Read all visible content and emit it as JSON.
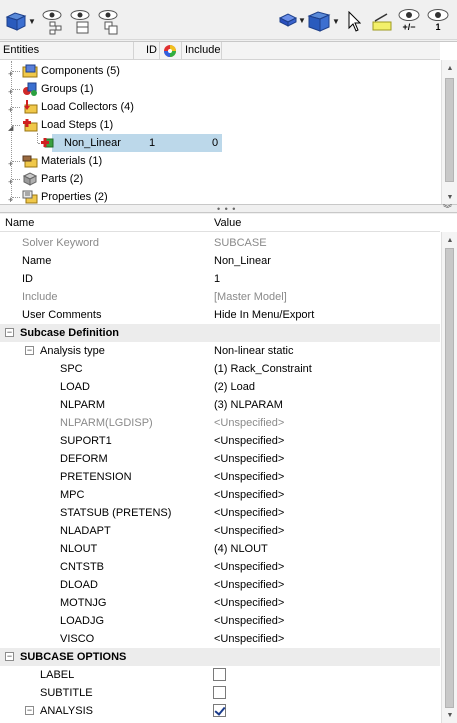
{
  "toolbar": {
    "left_icons": [
      "entity-view-icon",
      "entity-state-icon",
      "entity-filter-icon",
      "entity-config-icon"
    ],
    "right_icons": [
      "display-mode-icon",
      "view-mode-icon",
      "select-cursor-icon",
      "highlight-icon",
      "show-hide-icon",
      "isolate-icon"
    ],
    "show_hide_label": "+/−",
    "isolate_label": "1"
  },
  "tree": {
    "columns": {
      "entities": "Entities",
      "id": "ID",
      "include": "Include"
    },
    "rows": [
      {
        "label": "Components (5)",
        "icon": "components-icon",
        "indent": 0,
        "expanded": false
      },
      {
        "label": "Groups (1)",
        "icon": "groups-icon",
        "indent": 0,
        "expanded": false
      },
      {
        "label": "Load Collectors (4)",
        "icon": "load-collectors-icon",
        "indent": 0,
        "expanded": false
      },
      {
        "label": "Load Steps (1)",
        "icon": "load-steps-icon",
        "indent": 0,
        "expanded": true
      },
      {
        "label": "Non_Linear",
        "icon": "load-step-icon",
        "indent": 1,
        "id": "1",
        "include": "0",
        "selected": true
      },
      {
        "label": "Materials (1)",
        "icon": "materials-icon",
        "indent": 0,
        "expanded": false
      },
      {
        "label": "Parts (2)",
        "icon": "parts-icon",
        "indent": 0,
        "expanded": false
      },
      {
        "label": "Properties (2)",
        "icon": "properties-icon",
        "indent": 0,
        "expanded": false
      }
    ],
    "selected_id": "1",
    "selected_include": "0"
  },
  "props": {
    "header": {
      "name": "Name",
      "value": "Value"
    },
    "rows": [
      {
        "k": "Solver Keyword",
        "v": "SUBCASE",
        "grey": true
      },
      {
        "k": "Name",
        "v": "Non_Linear"
      },
      {
        "k": "ID",
        "v": "1"
      },
      {
        "k": "Include",
        "v": "[Master Model]",
        "grey": true
      },
      {
        "k": "User Comments",
        "v": "Hide In Menu/Export"
      },
      {
        "k": "Subcase Definition",
        "section": true
      },
      {
        "k": "Analysis type",
        "v": "Non-linear static",
        "sub": true
      },
      {
        "k": "SPC",
        "v": "(1) Rack_Constraint",
        "leaf": true
      },
      {
        "k": "LOAD",
        "v": "(2) Load",
        "leaf": true
      },
      {
        "k": "NLPARM",
        "v": "(3) NLPARAM",
        "leaf": true
      },
      {
        "k": "NLPARM(LGDISP)",
        "v": "<Unspecified>",
        "leaf": true,
        "grey": true
      },
      {
        "k": "SUPORT1",
        "v": "<Unspecified>",
        "leaf": true
      },
      {
        "k": "DEFORM",
        "v": "<Unspecified>",
        "leaf": true
      },
      {
        "k": "PRETENSION",
        "v": "<Unspecified>",
        "leaf": true
      },
      {
        "k": "MPC",
        "v": "<Unspecified>",
        "leaf": true
      },
      {
        "k": "STATSUB (PRETENS)",
        "v": "<Unspecified>",
        "leaf": true
      },
      {
        "k": "NLADAPT",
        "v": "<Unspecified>",
        "leaf": true
      },
      {
        "k": "NLOUT",
        "v": "(4) NLOUT",
        "leaf": true
      },
      {
        "k": "CNTSTB",
        "v": "<Unspecified>",
        "leaf": true
      },
      {
        "k": "DLOAD",
        "v": "<Unspecified>",
        "leaf": true
      },
      {
        "k": "MOTNJG",
        "v": "<Unspecified>",
        "leaf": true
      },
      {
        "k": "LOADJG",
        "v": "<Unspecified>",
        "leaf": true
      },
      {
        "k": "VISCO",
        "v": "<Unspecified>",
        "leaf": true
      },
      {
        "k": "SUBCASE OPTIONS",
        "section": true
      },
      {
        "k": "LABEL",
        "check": false,
        "opt": true
      },
      {
        "k": "SUBTITLE",
        "check": false,
        "opt": true
      },
      {
        "k": "ANALYSIS",
        "check": true,
        "opt": true,
        "box": true
      }
    ]
  },
  "colors": {
    "selection": "#bcd8ea",
    "section_bg": "#ececec",
    "grey_text": "#8a8a8a"
  }
}
